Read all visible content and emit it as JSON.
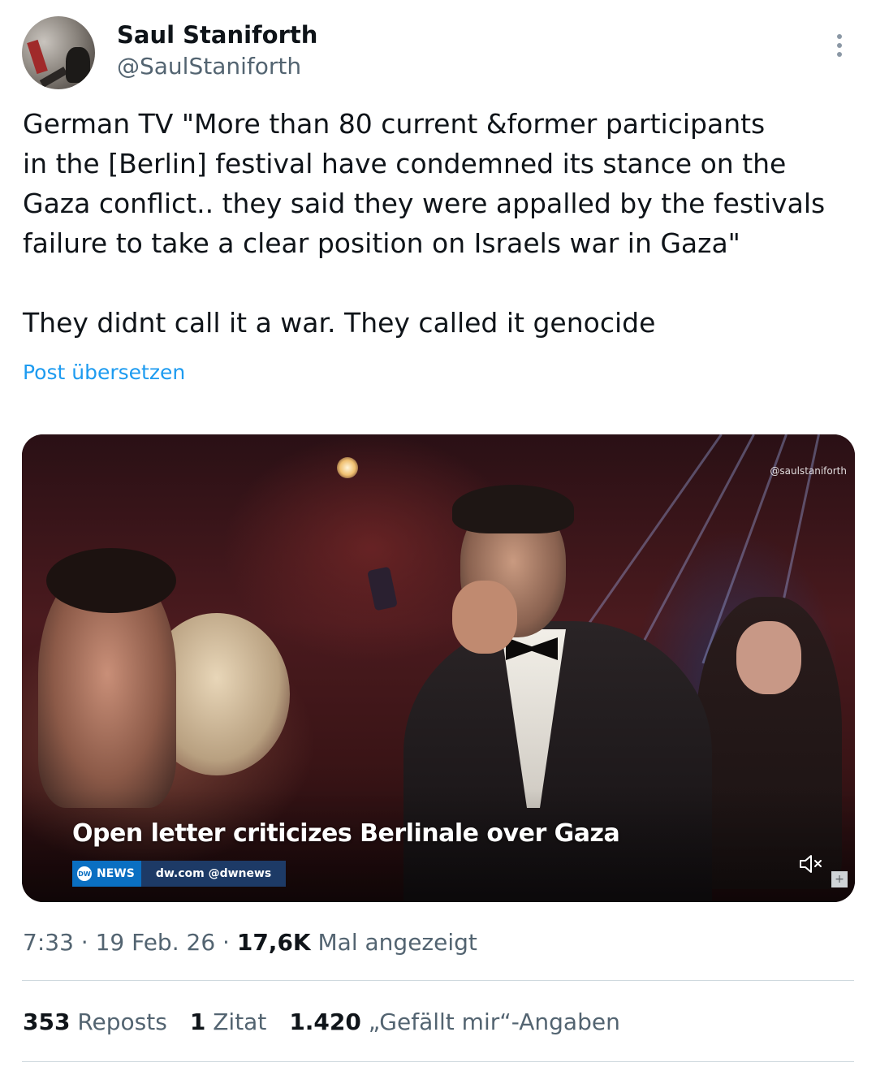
{
  "author": {
    "name": "Saul Staniforth",
    "handle": "@SaulStaniforth"
  },
  "tweet": {
    "lines": [
      "German TV \"More than 80 current &former participants",
      "in the [Berlin] festival have condemned its stance on the",
      "Gaza conflict.. they said they were appalled by the festivals",
      "failure to take a clear position on Israels war in Gaza\"",
      "",
      "They didnt call it a war. They called it genocide"
    ],
    "translate_label": "Post übersetzen"
  },
  "media": {
    "watermark": "@saulstaniforth",
    "headline": "Open letter criticizes Berlinale over Gaza",
    "badge_logo": "DW",
    "badge_news": "NEWS",
    "badge_source": "dw.com @dwnews",
    "expand_symbol": "+"
  },
  "meta": {
    "time": "7:33",
    "sep1": " · ",
    "date": "19 Feb. 26",
    "sep2": " · ",
    "views": "17,6K",
    "views_label": " Mal angezeigt"
  },
  "stats": {
    "reposts_count": "353",
    "reposts_label": " Reposts",
    "quotes_count": "1",
    "quotes_label": " Zitat",
    "likes_count": "1.420",
    "likes_label": " „Gefällt mir“-Angaben"
  },
  "colors": {
    "text": "#0f1419",
    "secondary": "#536471",
    "link": "#1d9bf0",
    "divider": "#cfd9de",
    "dw_blue": "#0a6fc2"
  }
}
